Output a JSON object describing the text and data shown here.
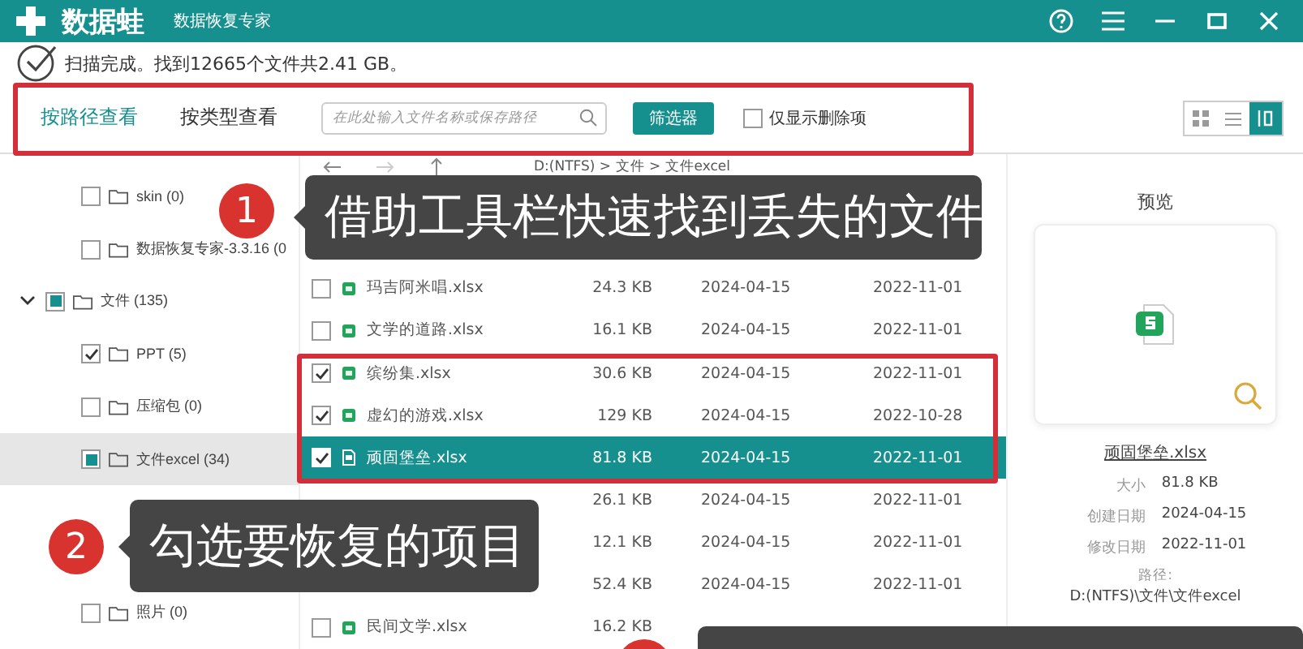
{
  "app": {
    "name": "数据蛙",
    "subtitle": "数据恢复专家"
  },
  "scan_status": "扫描完成。找到12665个文件共2.41 GB。",
  "view_tabs": [
    {
      "label": "按路径查看",
      "selected": true
    },
    {
      "label": "按类型查看",
      "selected": false
    }
  ],
  "search": {
    "placeholder": "在此处输入文件名称或保存路径"
  },
  "filter_button": "筛选器",
  "deleted_only": {
    "label": "仅显示删除项",
    "checked": false
  },
  "view_modes": [
    {
      "kind": "grid",
      "selected": false
    },
    {
      "kind": "list",
      "selected": false
    },
    {
      "kind": "detail",
      "selected": true
    }
  ],
  "tree": [
    {
      "children": [
        {
          "label": "skin (0)",
          "checked": false,
          "selected": false
        },
        {
          "label": "数据恢复专家-3.3.16 (0",
          "checked": false,
          "selected": false
        }
      ]
    },
    {
      "label": "文件 (135)",
      "checked": false,
      "partial": true,
      "selected": false,
      "expanded": true,
      "children": [
        {
          "label": "PPT (5)",
          "checked": true,
          "selected": false
        },
        {
          "label": "压缩包 (0)",
          "checked": false,
          "selected": false
        },
        {
          "label": "文件excel (34)",
          "checked": false,
          "partial": true,
          "selected": true
        },
        {
          "label": "照片 (0)",
          "checked": false,
          "selected": false
        }
      ]
    }
  ],
  "breadcrumb": "D:(NTFS) > 文件 > 文件excel",
  "files": [
    {
      "name": "玛吉阿米唱.xlsx",
      "size": "24.3 KB",
      "created": "2024-04-15",
      "modified": "2022-11-01",
      "checked": false,
      "selected": false
    },
    {
      "name": "文学的道路.xlsx",
      "size": "16.1 KB",
      "created": "2024-04-15",
      "modified": "2022-11-01",
      "checked": false,
      "selected": false
    },
    {
      "name": "缤纷集.xlsx",
      "size": "30.6 KB",
      "created": "2024-04-15",
      "modified": "2022-11-01",
      "checked": true,
      "selected": false
    },
    {
      "name": "虚幻的游戏.xlsx",
      "size": "129 KB",
      "created": "2024-04-15",
      "modified": "2022-10-28",
      "checked": true,
      "selected": false
    },
    {
      "name": "顽固堡垒.xlsx",
      "size": "81.8 KB",
      "created": "2024-04-15",
      "modified": "2022-11-01",
      "checked": true,
      "selected": true
    },
    {
      "size": "26.1 KB",
      "created": "2024-04-15",
      "modified": "2022-11-01",
      "selected": false
    },
    {
      "size": "12.1 KB",
      "created": "2024-04-15",
      "modified": "2022-11-01",
      "selected": false
    },
    {
      "size": "52.4 KB",
      "created": "2024-04-15",
      "modified": "2022-11-01",
      "selected": false
    },
    {
      "name": "民间文学.xlsx",
      "size": "16.2 KB",
      "checked": false,
      "selected": false
    }
  ],
  "preview": {
    "title": "预览",
    "file_name": "顽固堡垒.xlsx",
    "details": [
      {
        "label": "大小",
        "value": "81.8 KB"
      },
      {
        "label": "创建日期",
        "value": "2024-04-15"
      },
      {
        "label": "修改日期",
        "value": "2022-11-01"
      }
    ],
    "path_label": "路径:",
    "path": "D:(NTFS)\\文件\\文件excel"
  },
  "callouts": [
    {
      "number": "1",
      "text": "借助工具栏快速找到丢失的文件"
    },
    {
      "number": "2",
      "text": "勾选要恢复的项目"
    }
  ]
}
